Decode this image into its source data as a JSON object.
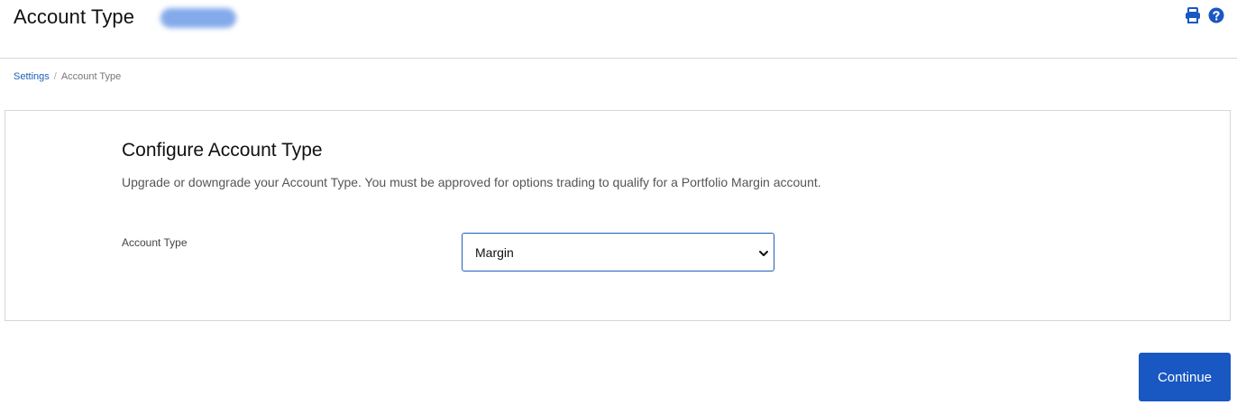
{
  "header": {
    "title": "Account Type",
    "icons": [
      "print-icon",
      "help-icon"
    ],
    "accent_color": "#1957c2"
  },
  "breadcrumb": {
    "items": [
      "Settings",
      "Account Type"
    ],
    "separator": "/"
  },
  "card": {
    "title": "Configure Account Type",
    "description": "Upgrade or downgrade your Account Type. You must be approved for options trading to qualify for a Portfolio Margin account.",
    "field": {
      "label": "Account Type",
      "selected_value": "Margin"
    }
  },
  "actions": {
    "continue_label": "Continue"
  }
}
